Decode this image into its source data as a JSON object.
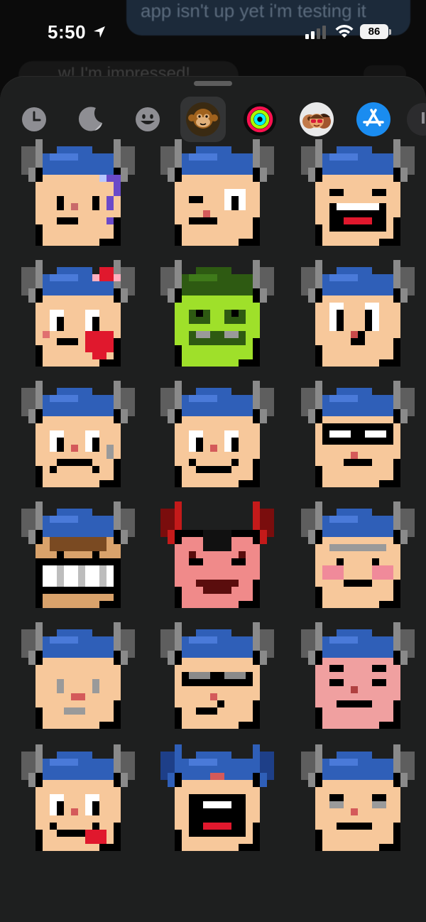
{
  "background_chat": {
    "top_message": "app isn't up yet i'm testing it",
    "middle_message": "w! I'm impressed!"
  },
  "status_bar": {
    "time": "5:50",
    "battery": "86",
    "icons": [
      "location-arrow-icon",
      "cellular-signal-icon",
      "wifi-icon",
      "battery-icon"
    ]
  },
  "drawer": {
    "tabs": [
      {
        "name": "recents",
        "icon": "clock-icon",
        "selected": false
      },
      {
        "name": "stickers",
        "icon": "moon-sticker-icon",
        "selected": false
      },
      {
        "name": "emoji",
        "icon": "smiley-icon",
        "selected": false
      },
      {
        "name": "sticker-pack",
        "icon": "monkey-icon",
        "selected": true
      },
      {
        "name": "fitness",
        "icon": "activity-rings-icon",
        "selected": false
      },
      {
        "name": "memoji",
        "icon": "memoji-icon",
        "selected": false
      },
      {
        "name": "app-store",
        "icon": "app-store-icon",
        "selected": false
      },
      {
        "name": "more",
        "icon": "more-apps-icon",
        "selected": false
      }
    ],
    "stickers": [
      {
        "name": "viking-confused",
        "expression": "question mark"
      },
      {
        "name": "viking-wink",
        "expression": "wink"
      },
      {
        "name": "viking-laugh",
        "expression": "laughing"
      },
      {
        "name": "viking-love",
        "expression": "heart and bow"
      },
      {
        "name": "viking-zombie",
        "expression": "green monster"
      },
      {
        "name": "viking-surprised",
        "expression": "surprised"
      },
      {
        "name": "viking-sad",
        "expression": "frown"
      },
      {
        "name": "viking-smile",
        "expression": "smile"
      },
      {
        "name": "viking-cool",
        "expression": "sunglasses"
      },
      {
        "name": "viking-grin",
        "expression": "big teeth grin"
      },
      {
        "name": "viking-devil",
        "expression": "red devil"
      },
      {
        "name": "viking-blush",
        "expression": "blushing"
      },
      {
        "name": "viking-neutral",
        "expression": "neutral"
      },
      {
        "name": "viking-shades",
        "expression": "shades smirk"
      },
      {
        "name": "viking-angry",
        "expression": "angry red"
      },
      {
        "name": "viking-tongue",
        "expression": "tongue out"
      },
      {
        "name": "viking-shout",
        "expression": "shouting"
      },
      {
        "name": "viking-annoyed",
        "expression": "annoyed"
      }
    ]
  }
}
